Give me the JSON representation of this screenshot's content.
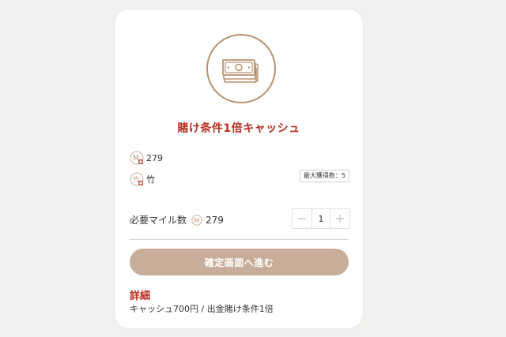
{
  "reward": {
    "title": "賭け条件1倍キャッシュ",
    "icon": "cash-stack-icon",
    "accent_color": "#b72a1c",
    "icon_color": "#b7916f"
  },
  "info": {
    "miles_value": "279",
    "rank_label": "竹",
    "rank_icon_letter": "竹",
    "mile_icon_letter": "M",
    "max_redeem_label": "最大獲得数：5"
  },
  "exchange": {
    "required_label": "必要マイル数",
    "required_value": "279",
    "quantity": "1",
    "minus_label": "−",
    "plus_label": "+"
  },
  "cta": {
    "label": "確定画面へ進む",
    "color": "#c8ae9a"
  },
  "details": {
    "heading": "詳細",
    "text": "キャッシュ700円 / 出金賭け条件1倍"
  }
}
